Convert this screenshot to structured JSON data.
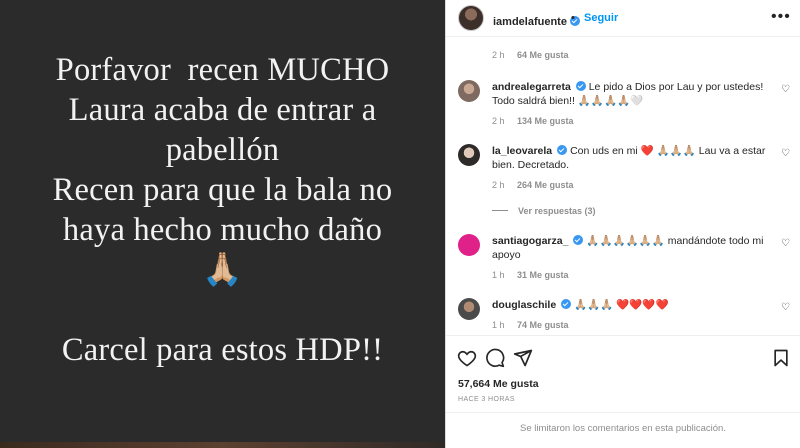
{
  "media": {
    "lines": [
      "Porfavor  recen MUCHO",
      "Laura acaba de entrar a",
      "pabellón",
      "Recen para que la bala no",
      "haya hecho mucho daño",
      "",
      "",
      "Carcel para estos HDP!!"
    ],
    "emoji": "🙏🏼"
  },
  "header": {
    "username": "iamdelafuente",
    "separator": "•",
    "follow_label": "Seguir",
    "more_icon": "more-horizontal-icon"
  },
  "top_meta": {
    "time": "2 h",
    "likes": "64 Me gusta"
  },
  "comments": [
    {
      "username": "andrealegarreta",
      "verified": true,
      "text": "Le pido a Dios por Lau y por ustedes! Todo saldrá bien!! 🙏🏼🙏🏼🙏🏼🙏🏼🤍",
      "time": "2 h",
      "likes": "134 Me gusta"
    },
    {
      "username": "la_leovarela",
      "verified": true,
      "text": "Con uds en mi ❤️ 🙏🏼🙏🏼🙏🏼 Lau va a estar bien. Decretado.",
      "time": "2 h",
      "likes": "264 Me gusta",
      "view_replies": "Ver respuestas (3)"
    },
    {
      "username": "santiagogarza_",
      "verified": true,
      "text": "🙏🏼🙏🏼🙏🏼🙏🏼🙏🏼🙏🏼 mandándote todo mi apoyo",
      "time": "1 h",
      "likes": "31 Me gusta"
    },
    {
      "username": "douglaschile",
      "verified": true,
      "text": "🙏🏼🙏🏼🙏🏼 ❤️❤️❤️❤️",
      "time": "1 h",
      "likes": "74 Me gusta"
    }
  ],
  "footer": {
    "likes": "57,664 Me gusta",
    "time": "HACE 3 HORAS",
    "comments_limited": "Se limitaron los comentarios en esta publicación."
  },
  "colors": {
    "accent": "#0095f6",
    "verified": "#3897f0",
    "muted": "#8e8e8e",
    "text": "#262626",
    "media_bg": "#2b2b2b",
    "santiagogarza_avatar": "#e0218a"
  }
}
